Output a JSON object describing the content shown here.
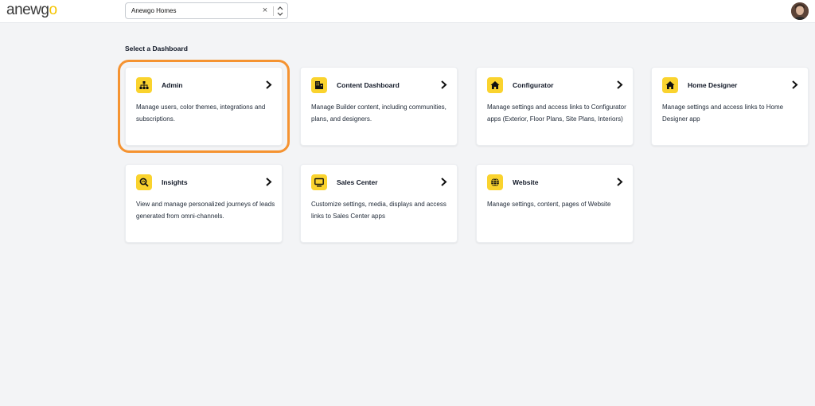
{
  "header": {
    "logo_prefix": "a",
    "logo_o": "o",
    "logo_mid": "newg",
    "logo_o2": "o",
    "org_select": {
      "value": "Anewgo Homes",
      "clear": "×"
    }
  },
  "main": {
    "title": "Select a Dashboard",
    "cards": [
      {
        "title": "Admin",
        "icon": "org-chart-icon",
        "description": "Manage users, color themes, integrations and subscriptions."
      },
      {
        "title": "Content Dashboard",
        "icon": "building-icon",
        "description": "Manage Builder content, including communities, plans, and designers."
      },
      {
        "title": "Configurator",
        "icon": "home-icon",
        "description": "Manage settings and access links to Configurator apps (Exterior, Floor Plans, Site Plans, Interiors)"
      },
      {
        "title": "Home Designer",
        "icon": "home-icon",
        "description": "Manage settings and access links to Home Designer app"
      },
      {
        "title": "Insights",
        "icon": "search-insights-icon",
        "description": "View and manage personalized journeys of leads generated from omni-channels."
      },
      {
        "title": "Sales Center",
        "icon": "monitor-icon",
        "description": "Customize settings, media, displays and access links to Sales Center apps"
      },
      {
        "title": "Website",
        "icon": "globe-icon",
        "description": "Manage settings, content, pages of Website"
      }
    ]
  },
  "colors": {
    "accent": "#fad32e",
    "highlight": "#f59331",
    "background": "#f3f4f6"
  }
}
